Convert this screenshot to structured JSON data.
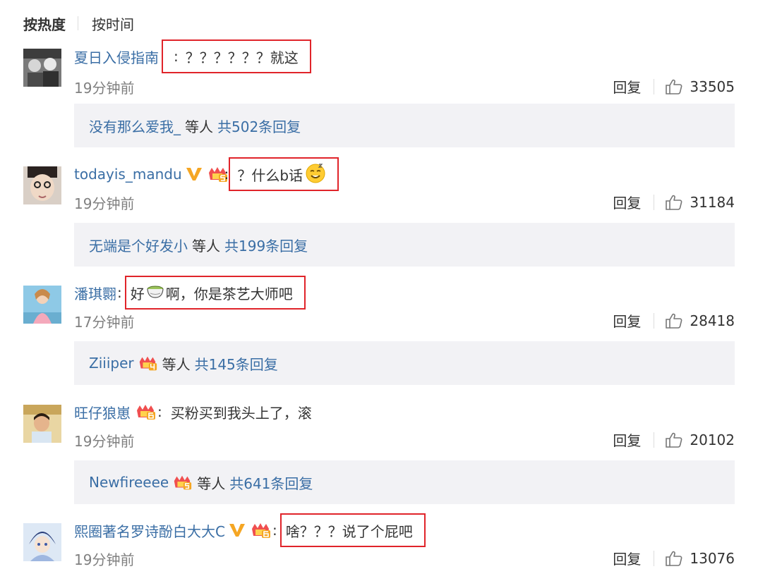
{
  "sort": {
    "hot": "按热度",
    "time": "按时间"
  },
  "reply_label": "回复",
  "comments": [
    {
      "user": "夏日入侵指南",
      "colon": ":",
      "text": "？？？？？？就这",
      "time": "19分钟前",
      "likes": "33505",
      "sub": {
        "user": "没有那么爱我_",
        "mid": "等人",
        "total": "共502条回复"
      }
    },
    {
      "user": "todayis_mandu",
      "colon": ":",
      "text": "？什么b话",
      "emoji": "dizzy-smile-emoji",
      "time": "19分钟前",
      "likes": "31184",
      "sub": {
        "user": "无端是个好发小",
        "mid": "等人",
        "total": "共199条回复"
      }
    },
    {
      "user": "潘琪翾",
      "colon": ":",
      "text_before": "好",
      "emoji": "tea-bowl-emoji",
      "text": "啊，你是茶艺大师吧",
      "time": "17分钟前",
      "likes": "28418",
      "sub": {
        "user": "Ziiiper",
        "mid": "等人",
        "total": "共145条回复"
      }
    },
    {
      "user": "旺仔狼崽",
      "colon": ":",
      "text": "买粉买到我头上了，滚",
      "time": "19分钟前",
      "likes": "20102",
      "sub": {
        "user": "Newfireeee",
        "mid": "等人",
        "total": "共641条回复"
      }
    },
    {
      "user": "熙圈著名罗诗酚白大大C",
      "colon": ":",
      "text": "啥？？？说了个屁吧",
      "time": "19分钟前",
      "likes": "13076"
    }
  ],
  "colors": {
    "link": "#3a6ea5",
    "highlight_border": "#e0242a",
    "vip": "#f5a623",
    "fan_badge": "#f04f4f",
    "sub_bg": "#f2f2f5"
  },
  "icons": {
    "like": "thumbs-up-icon",
    "vip": "vip-v-icon",
    "fan": "fan-level-badge-icon"
  }
}
